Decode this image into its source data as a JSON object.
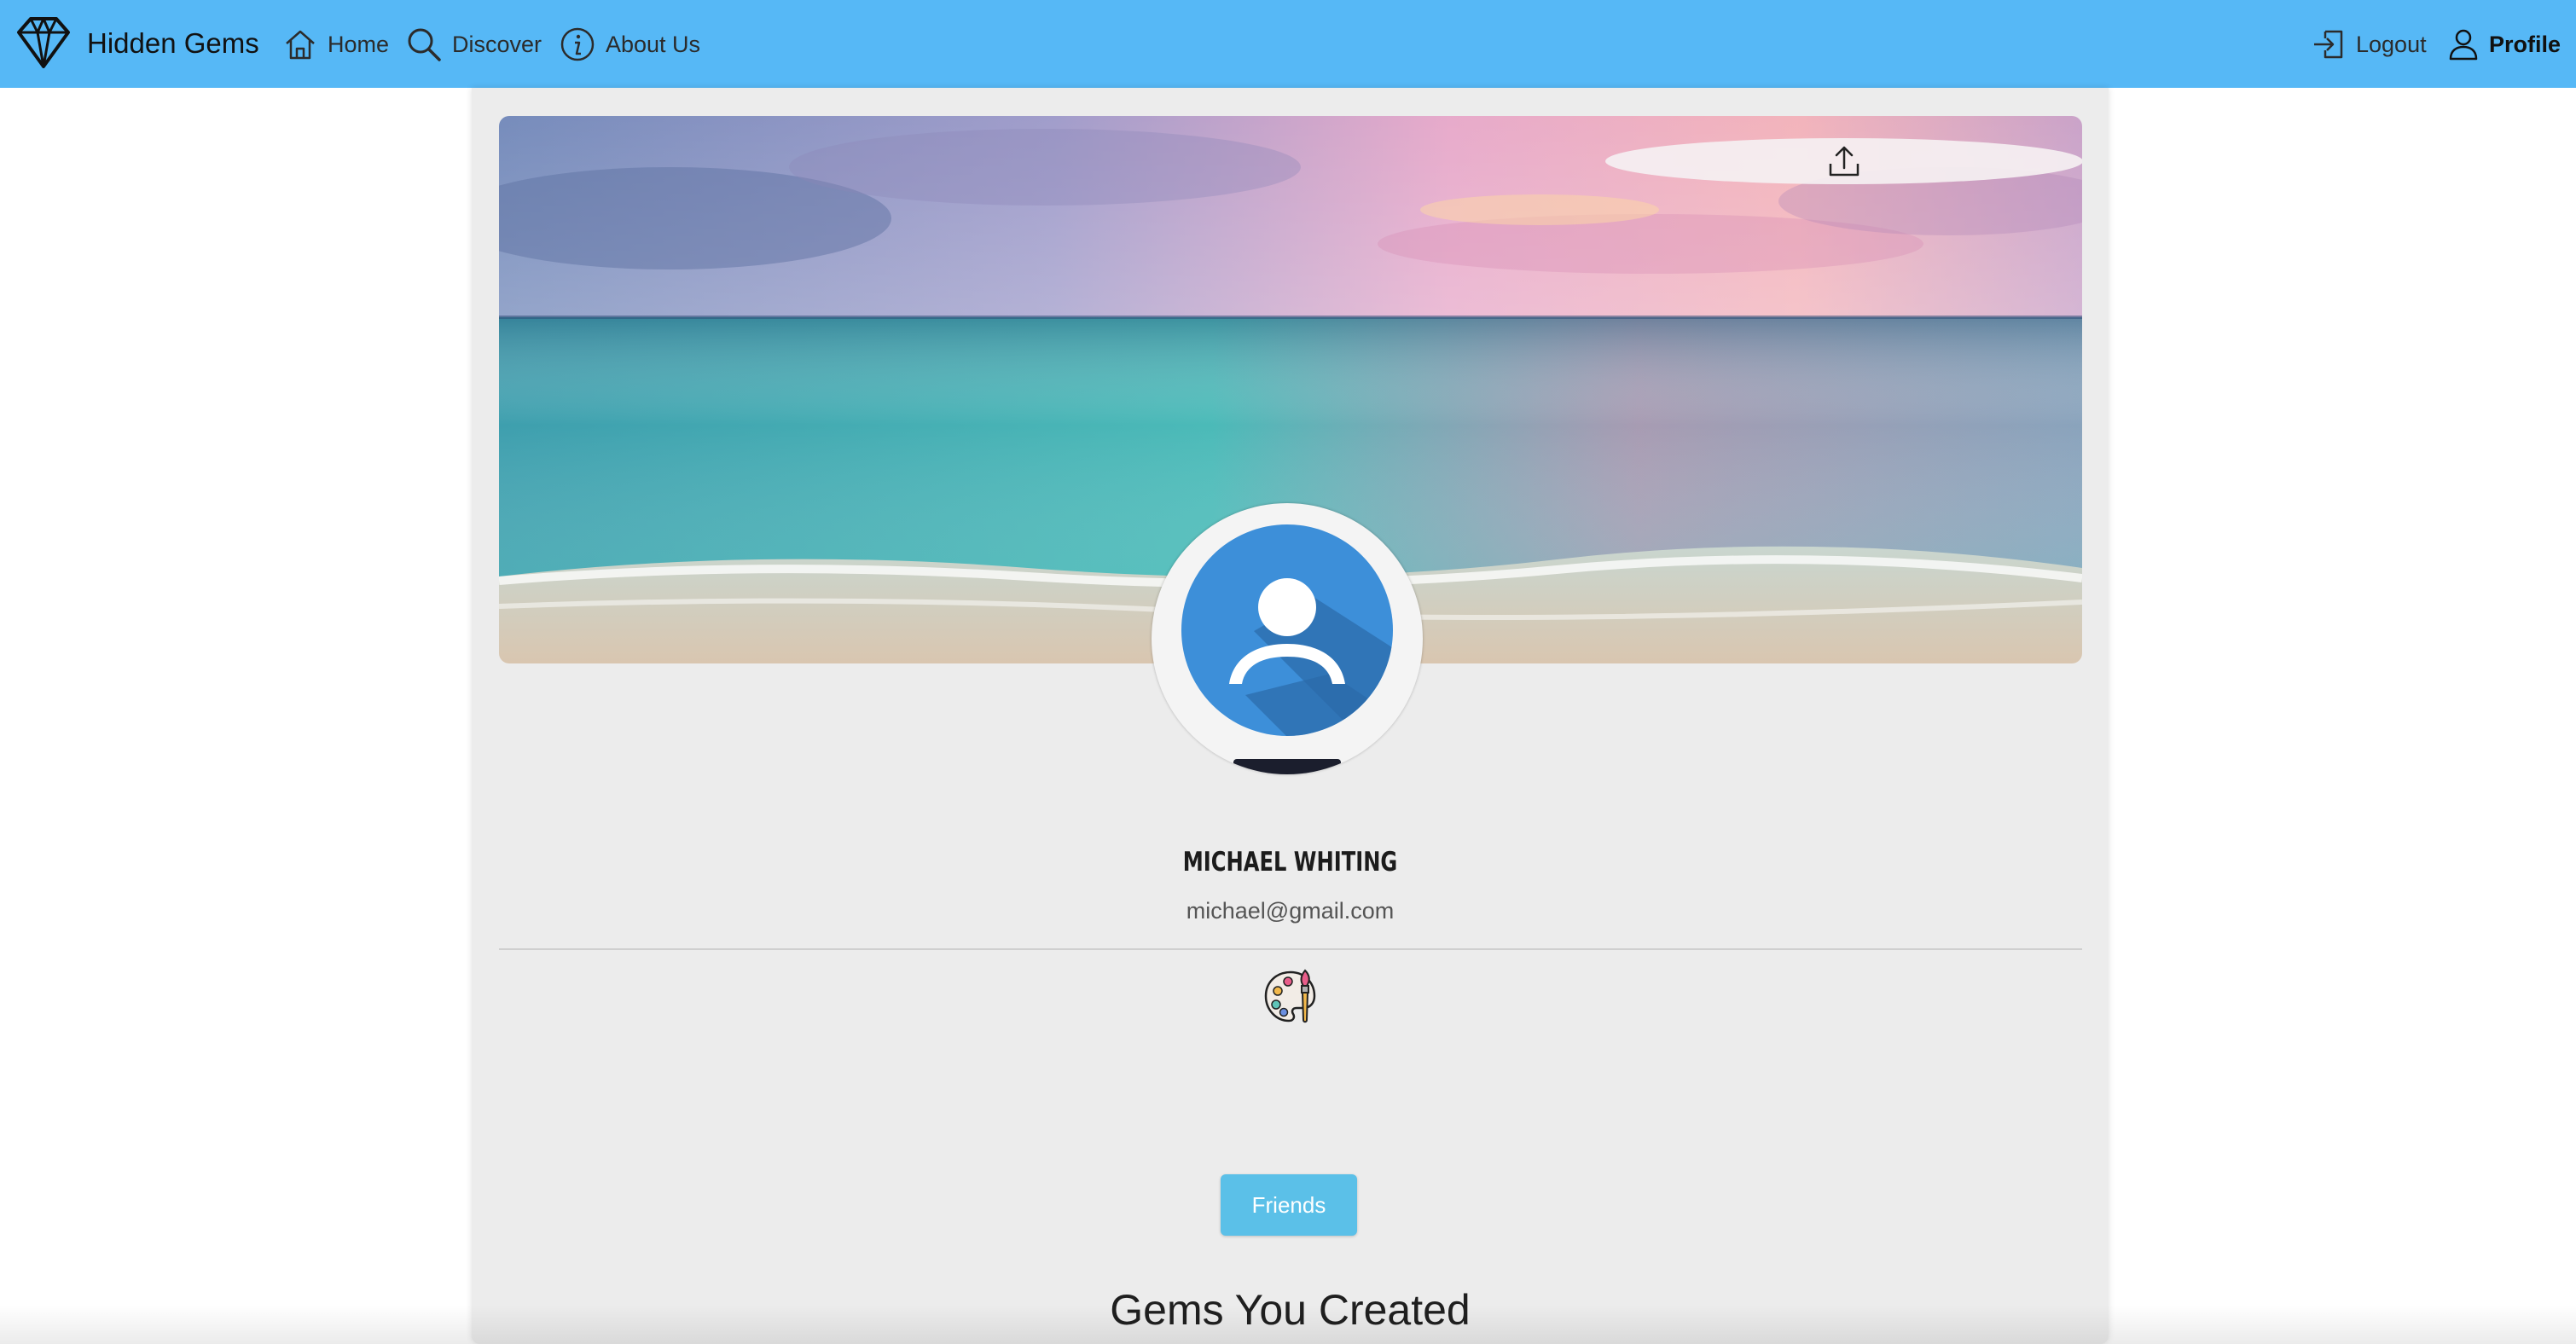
{
  "navbar": {
    "brand_name": "Hidden Gems",
    "brand_icon": "diamond-icon",
    "links": [
      {
        "label": "Home",
        "icon": "home-icon"
      },
      {
        "label": "Discover",
        "icon": "search-icon"
      },
      {
        "label": "About Us",
        "icon": "info-icon"
      }
    ],
    "logout_label": "Logout",
    "profile_label": "Profile",
    "background_color": "#56b8f6"
  },
  "profile": {
    "cover_upload_icon": "upload-icon",
    "avatar_icon": "user-avatar-icon",
    "name": "MICHAEL WHITING",
    "email": "michael@gmail.com",
    "interests": [
      {
        "icon": "art-palette-icon"
      }
    ],
    "friends_button_label": "Friends",
    "section_title": "Gems You Created"
  },
  "colors": {
    "accent_button": "#5bc0e8",
    "card_background": "#ececec",
    "avatar_blue": "#3d8fd9"
  }
}
